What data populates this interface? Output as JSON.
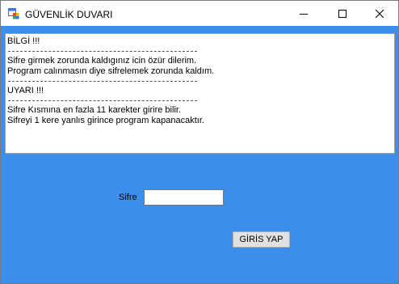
{
  "window": {
    "title": "GÜVENLİK DUVARI",
    "icon": "app-form-icon",
    "controls": [
      "minimize-icon",
      "maximize-icon",
      "close-icon"
    ]
  },
  "info_box": {
    "lines": [
      {
        "type": "text",
        "text": "BİLGİ !!!"
      },
      {
        "type": "separator"
      },
      {
        "type": "text",
        "text": "Sifre girmek zorunda kaldıgınız icin özür dilerim."
      },
      {
        "type": "text",
        "text": "Program calınmasın diye sifrelemek zorunda kaldım."
      },
      {
        "type": "separator"
      },
      {
        "type": "text",
        "text": "UYARI !!!"
      },
      {
        "type": "separator"
      },
      {
        "type": "text",
        "text": "Sifre Kısmına en fazla 11 karekter girire bilir."
      },
      {
        "type": "text",
        "text": "Sifreyi 1 kere yanlıs girince program kapanacaktır."
      }
    ]
  },
  "form": {
    "password_label": "Sifre",
    "password_value": "",
    "login_button": "GİRİS YAP"
  },
  "colors": {
    "background": "#3b8fea",
    "titlebar": "#ffffff"
  }
}
